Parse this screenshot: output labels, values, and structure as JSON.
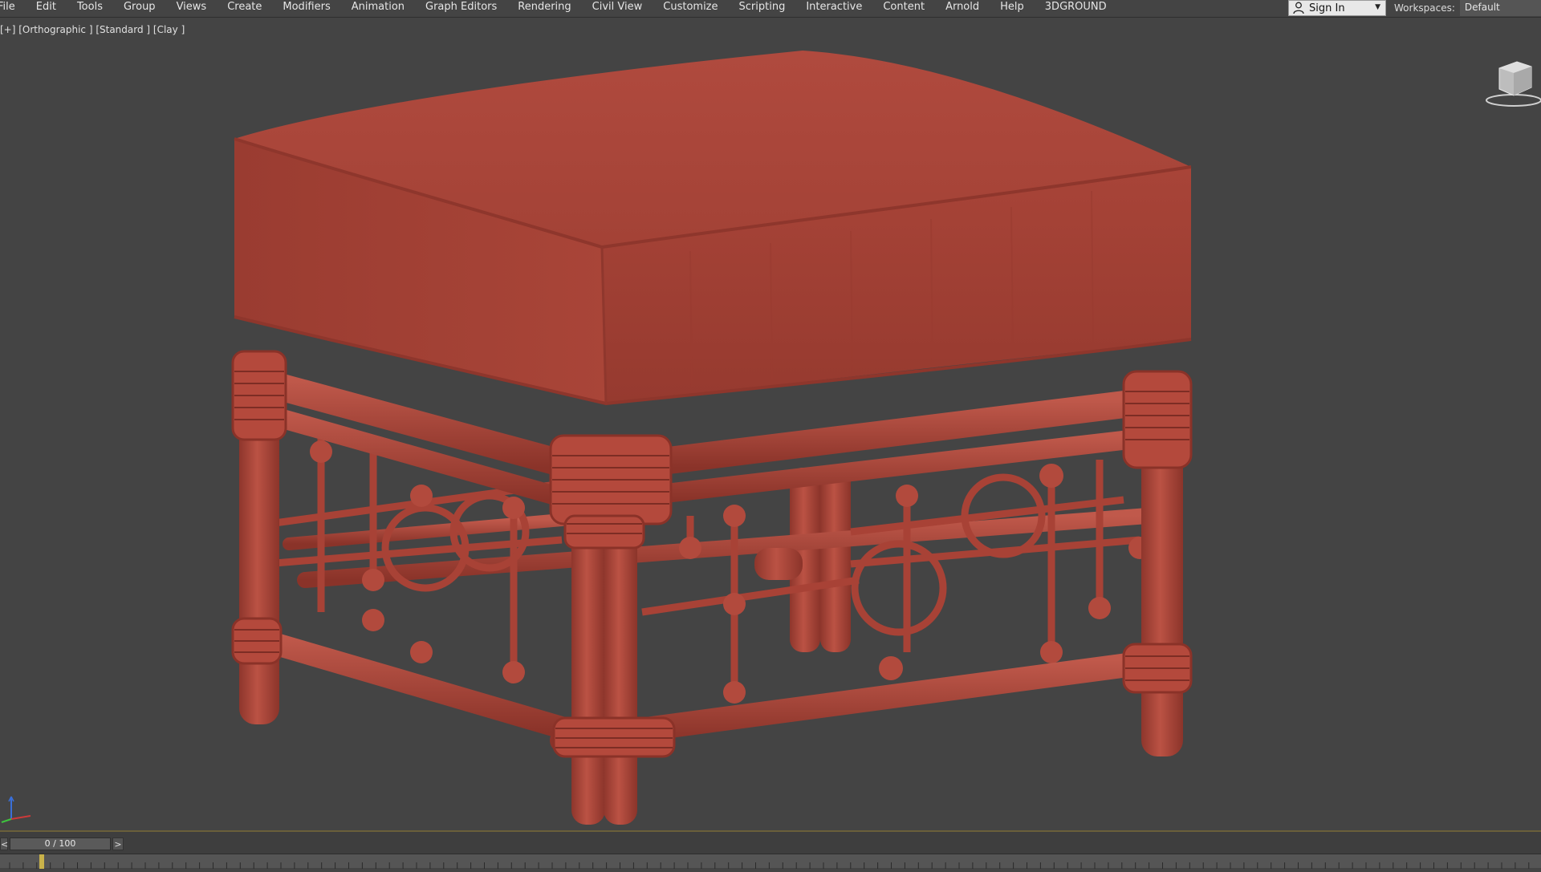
{
  "menubar": {
    "items": [
      "File",
      "Edit",
      "Tools",
      "Group",
      "Views",
      "Create",
      "Modifiers",
      "Animation",
      "Graph Editors",
      "Rendering",
      "Civil View",
      "Customize",
      "Scripting",
      "Interactive",
      "Content",
      "Arnold",
      "Help",
      "3DGROUND"
    ],
    "sign_in_label": "Sign In",
    "workspaces_label": "Workspaces:",
    "workspaces_value": "Default"
  },
  "viewport": {
    "label": "[+] [Orthographic ] [Standard ] [Clay ]",
    "model_color": "#b84a3e",
    "background_color": "#444444"
  },
  "timeline": {
    "prev_label": "<",
    "next_label": ">",
    "frame_display": "0 / 100",
    "marker_color": "#c9b24a"
  },
  "icons": [
    "user-icon",
    "viewcube-icon",
    "axis-tripod-icon"
  ]
}
